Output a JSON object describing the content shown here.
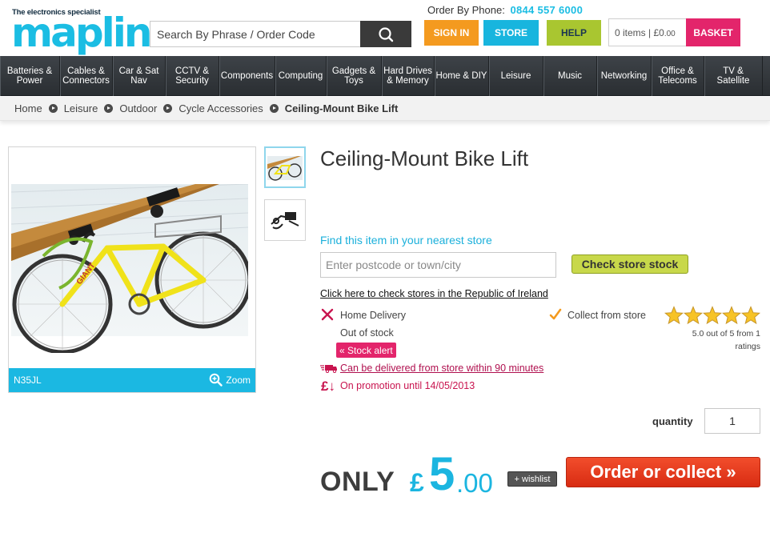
{
  "header": {
    "logo_tagline": "The electronics specialist",
    "logo_word": "maplin",
    "search_placeholder": "Search By Phrase / Order Code",
    "phone_label": "Order By Phone:",
    "phone_number": "0844 557 6000",
    "signin_label": "SIGN IN",
    "store_label": "STORE",
    "help_label": "HELP",
    "basket_items": "0 items | £0",
    "basket_pence": ".00",
    "basket_label": "BASKET"
  },
  "nav": {
    "items": [
      {
        "line1": "Batteries &",
        "line2": "Power"
      },
      {
        "line1": "Cables &",
        "line2": "Connectors"
      },
      {
        "line1": "Car & Sat",
        "line2": "Nav"
      },
      {
        "line1": "CCTV &",
        "line2": "Security"
      },
      {
        "line1": "Components",
        "line2": ""
      },
      {
        "line1": "Computing",
        "line2": ""
      },
      {
        "line1": "Gadgets &",
        "line2": "Toys"
      },
      {
        "line1": "Hard Drives",
        "line2": "& Memory"
      },
      {
        "line1": "Home & DIY",
        "line2": ""
      },
      {
        "line1": "Leisure",
        "line2": ""
      },
      {
        "line1": "Music",
        "line2": ""
      },
      {
        "line1": "Networking",
        "line2": ""
      },
      {
        "line1": "Office &",
        "line2": "Telecoms"
      },
      {
        "line1": "TV &",
        "line2": "Satellite"
      }
    ]
  },
  "breadcrumb": {
    "items": [
      "Home",
      "Leisure",
      "Outdoor",
      "Cycle Accessories"
    ],
    "current": "Ceiling-Mount Bike Lift"
  },
  "product": {
    "title": "Ceiling-Mount Bike Lift",
    "code": "N35JL",
    "zoom_label": "Zoom",
    "find_label": "Find this item in your nearest store",
    "postcode_placeholder": "Enter postcode or town/city",
    "check_stock_label": "Check store stock",
    "ireland_link": "Click here to check stores in the Republic of Ireland",
    "home_delivery_label": "Home Delivery",
    "out_of_stock": "Out of stock",
    "stock_alert": "« Stock alert",
    "store_delivery_link": "Can be delivered from store within 90 minutes",
    "promo_text": "On promotion until 14/05/2013",
    "collect_label": "Collect from store",
    "rating_value": 5.0,
    "rating_line1": "5.0 out of 5 from 1",
    "rating_line2": "ratings",
    "quantity_label": "quantity",
    "quantity_value": "1",
    "price_prefix": "ONLY",
    "price_currency": "£",
    "price_whole": "5",
    "price_decimal": ".00",
    "wishlist_label": "+ wishlist",
    "order_label": "Order or collect »"
  },
  "colors": {
    "brand_blue": "#1bbde3",
    "signin_orange": "#f49a1f",
    "help_green": "#a9c630",
    "basket_pink": "#e3256b",
    "order_red": "#e33a1c"
  },
  "icons": {
    "search": "search-icon",
    "zoom": "magnifier-icon",
    "delivery": "cross-icon",
    "collect": "checkmark-icon",
    "van": "delivery-van-icon",
    "promo": "pound-down-icon",
    "stars": "star-icon"
  }
}
